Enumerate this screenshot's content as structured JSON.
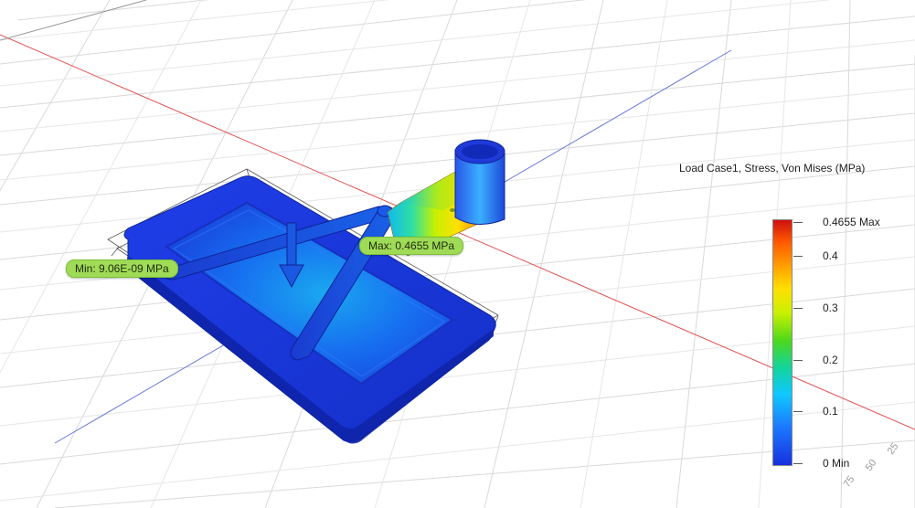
{
  "legend": {
    "title": "Load Case1, Stress, Von Mises (MPa)",
    "ticks": [
      {
        "label": "0.4655 Max",
        "value": 0.4655
      },
      {
        "label": "0.4",
        "value": 0.4
      },
      {
        "label": "0.3",
        "value": 0.3
      },
      {
        "label": "0.2",
        "value": 0.2
      },
      {
        "label": "0.1",
        "value": 0.1
      },
      {
        "label": "0 Min",
        "value": 0
      }
    ],
    "max_value": 0.4655,
    "colors": [
      "#d01010",
      "#ffe000",
      "#4fd81a",
      "#10c8ff",
      "#1730e0"
    ]
  },
  "probes": {
    "min_label": "Min: 9.06E-09 MPa",
    "max_label": "Max: 0.4655 MPa"
  },
  "grid": {
    "labels": [
      "25",
      "50",
      "75"
    ],
    "axis_colors": {
      "x": "#e05050",
      "y": "#6a78d8"
    }
  }
}
